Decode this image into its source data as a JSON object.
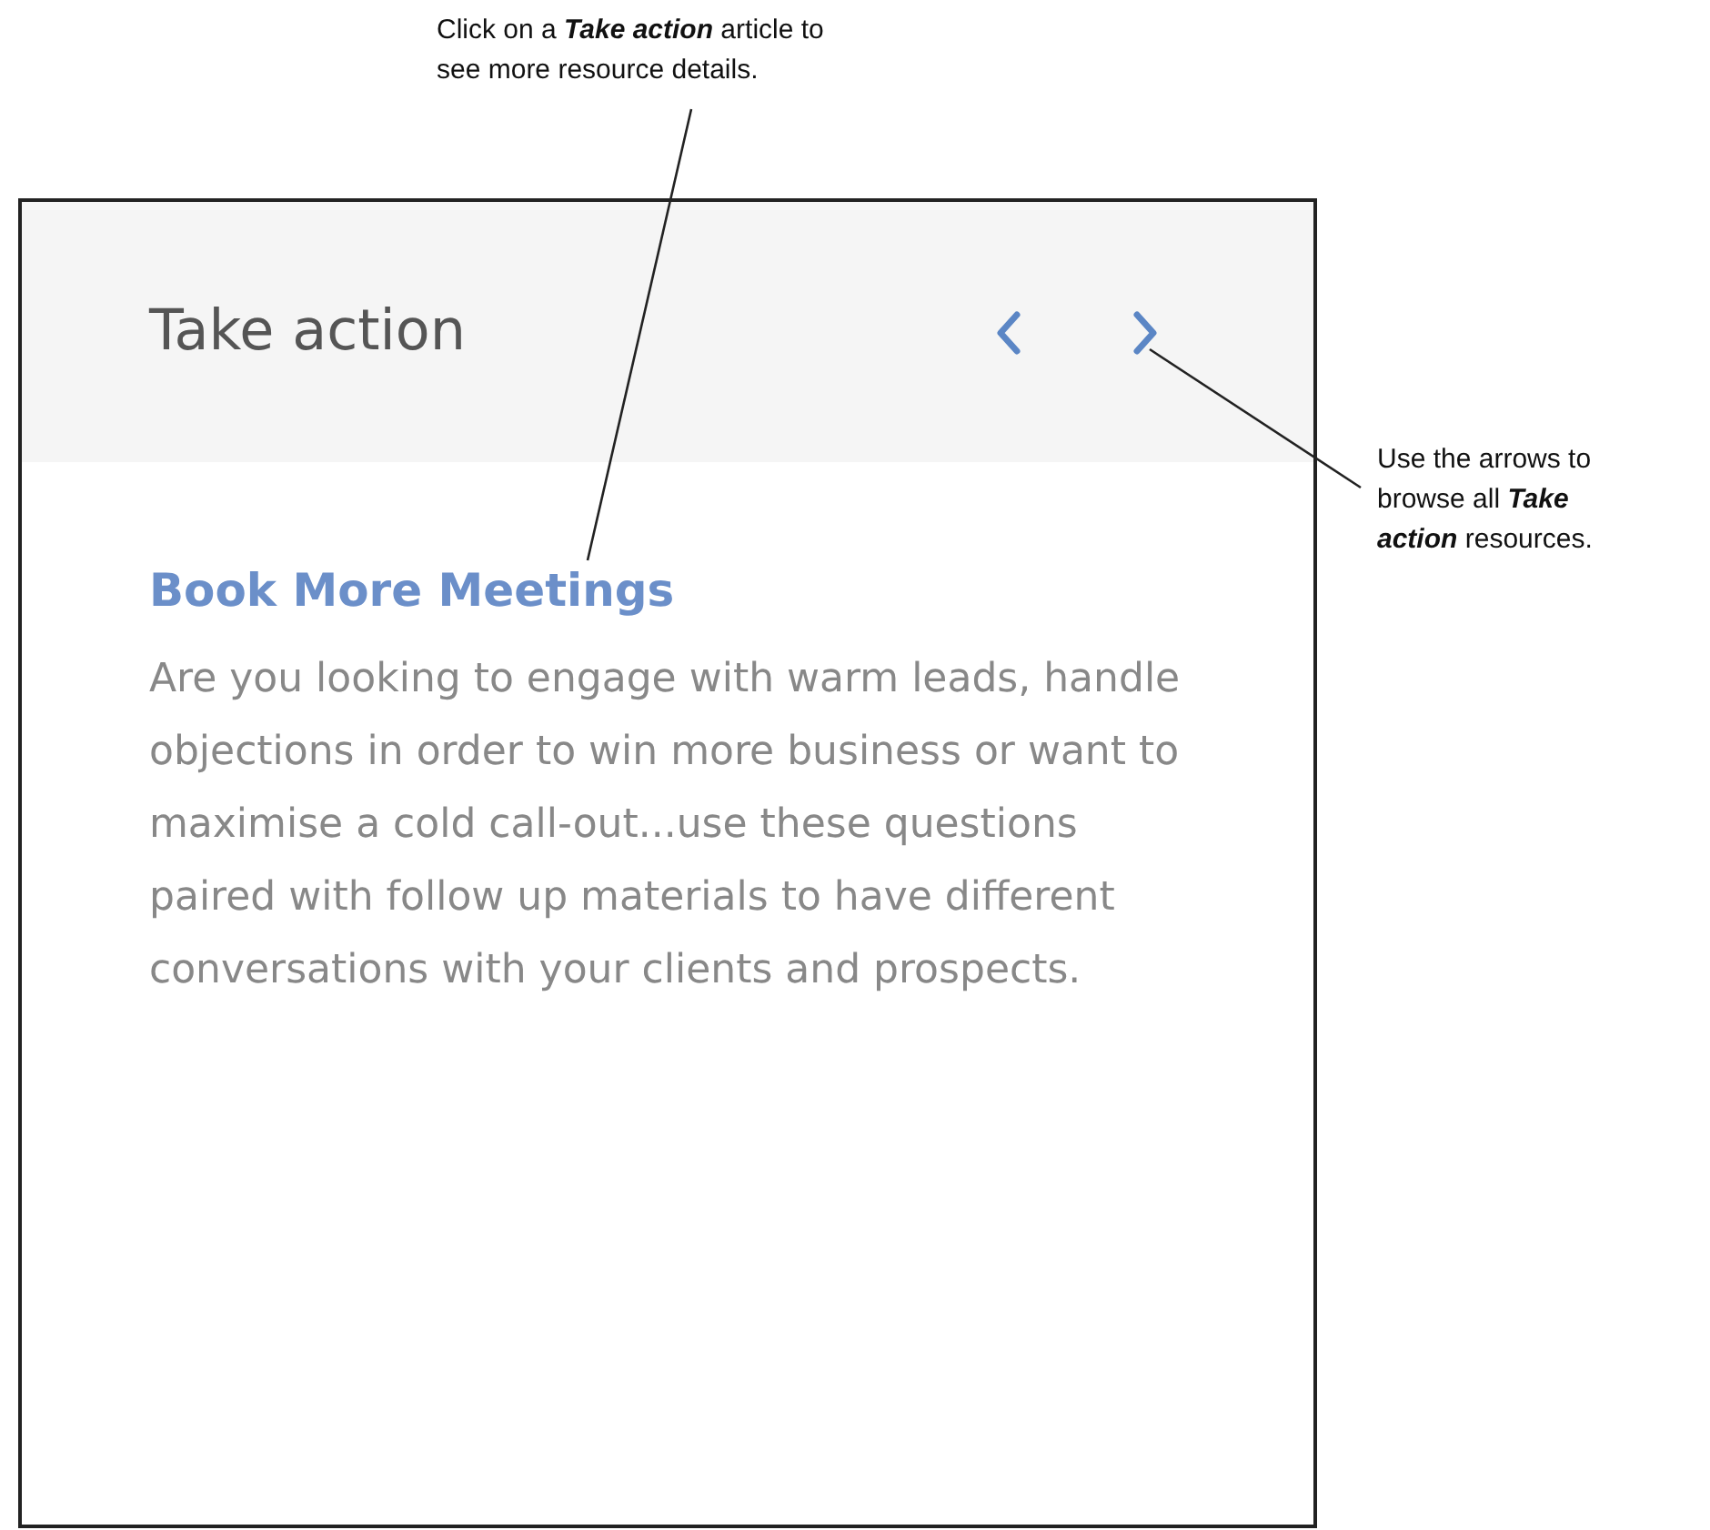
{
  "callouts": [
    {
      "text": "Click on a **Take action** article to see more resource details."
    },
    {
      "text": "Use the arrows to browse all **Take action** resources."
    }
  ],
  "panel": {
    "title": "Take action",
    "article": {
      "title": "Book More Meetings",
      "body": "Are you looking to engage with warm leads, handle objections in order to win more business or want to maximise a cold call-out...use these questions paired with follow up materials to have different conversations with your clients and prospects."
    }
  }
}
